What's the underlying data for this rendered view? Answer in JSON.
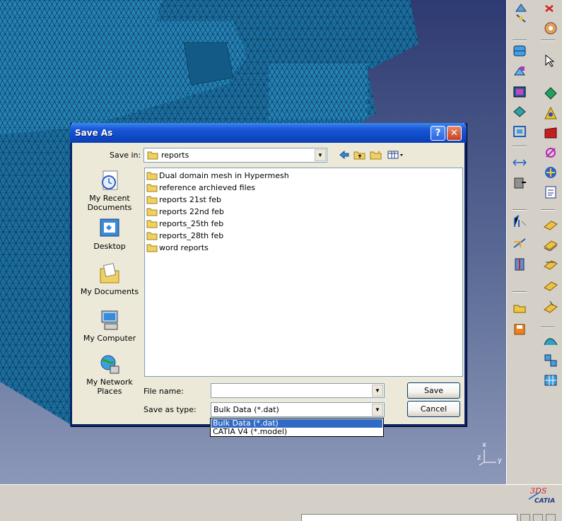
{
  "dialog": {
    "title": "Save As",
    "help_glyph": "?",
    "close_glyph": "✕",
    "save_in_label": "Save in:",
    "save_in_value": "reports",
    "places": [
      {
        "label": "My Recent Documents"
      },
      {
        "label": "Desktop"
      },
      {
        "label": "My Documents"
      },
      {
        "label": "My Computer"
      },
      {
        "label": "My Network Places"
      }
    ],
    "files": [
      "Dual domain mesh in Hypermesh",
      "reference archieved files",
      "reports 21st feb",
      "reports 22nd feb",
      "reports_25th feb",
      "reports_28th feb",
      "word reports"
    ],
    "file_name_label": "File name:",
    "file_name_value": "",
    "save_as_type_label": "Save as type:",
    "save_as_type_value": "Bulk Data (*.dat)",
    "type_options": [
      "Bulk Data (*.dat)",
      "CATIA V4 (*.model)"
    ],
    "save_button": "Save",
    "cancel_button": "Cancel"
  },
  "viewport": {
    "axis_x": "x",
    "axis_y": "y",
    "axis_z": "z"
  },
  "logo": {
    "brand": "CATIA",
    "mark": "3DS"
  },
  "colors": {
    "mesh": "#1a6ea0",
    "title_bar": "#0d45c0",
    "selection": "#316ac5"
  }
}
